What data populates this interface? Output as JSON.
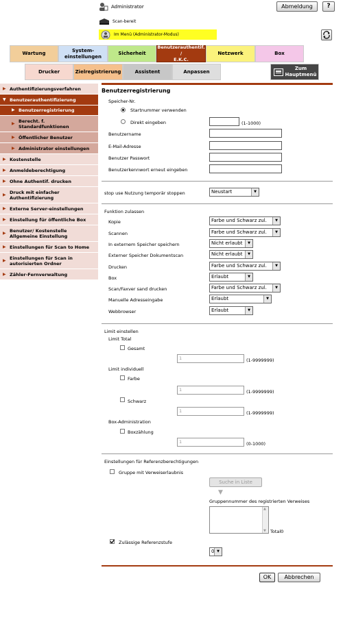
{
  "header": {
    "user": "Administrator",
    "logout": "Abmeldung",
    "help": "?",
    "status": "Scan-bereit",
    "mode": "Im Menü (Administrator-Modus)"
  },
  "tabs_row1": [
    "Wartung",
    "System-\neinstellungen",
    "Sicherheit",
    "Benutzerauthentif. /\nE.K.C.",
    "Netzwerk",
    "Box"
  ],
  "tabs_row2": [
    "Drucker",
    "Zielregistrierung",
    "Assistent",
    "Anpassen"
  ],
  "home_button": "Zum\nHauptmenü",
  "sidebar": [
    "Authentifizierungsverfahren",
    "Benutzerauthentifizierung",
    "Benutzerregistrierung",
    "Berecht. f.\nStandardfunktionen",
    "Öffentlicher Benutzer",
    "Administrator einstellungen",
    "Kostenstelle",
    "Anmeldeberechtigung",
    "Ohne Authentif. drucken",
    "Druck mit einfacher\nAuthentifizierung",
    "Externe Server-einstellungen",
    "Einstellung für öffentliche Box",
    "Benutzer/ Kostenstelle\nAllgemeine Einstellung",
    "Einstellungen für Scan to Home",
    "Einstellungen für Scan in\nautorisierten Ordner",
    "Zähler-Fernverwaltung"
  ],
  "form": {
    "title": "Benutzerregistrierung",
    "speicher_label": "Speicher-Nr.",
    "radio1": "Startnummer verwenden",
    "radio2": "Direkt eingeben",
    "range_1000": "(1-1000)",
    "username": "Benutzername",
    "email": "E-Mail-Adresse",
    "password": "Benutzer Passwort",
    "password2": "Benutzerkennwort erneut eingeben",
    "stop_label": "stop use Nutzung temporär stoppen",
    "stop_value": "Neustart",
    "funktion_title": "Funktion zulassen",
    "functions": [
      {
        "label": "Kopie",
        "value": "Farbe und Schwarz zul."
      },
      {
        "label": "Scannen",
        "value": "Farbe und Schwarz zul."
      },
      {
        "label": "In externem Speicher speichern",
        "value": "Nicht erlaubt"
      },
      {
        "label": "Externer Speicher Dokumentscan",
        "value": "Nicht erlaubt"
      },
      {
        "label": "Drucken",
        "value": "Farbe und Schwarz zul."
      },
      {
        "label": "Box",
        "value": "Erlaubt"
      },
      {
        "label": "Scan/Faxver sand drucken",
        "value": "Farbe und Schwarz zul."
      },
      {
        "label": "Manuelle Adresseingabe",
        "value": "Erlaubt"
      },
      {
        "label": "Webbrowser",
        "value": "Erlaubt"
      }
    ],
    "limit_title": "Limit einstellen",
    "limit_total": "Limit Total",
    "gesamt": "Gesamt",
    "limit_individuell": "Limit individuell",
    "farbe": "Farbe",
    "schwarz": "Schwarz",
    "box_admin": "Box-Administration",
    "boxzahlung": "Boxzählung",
    "input_value": "1",
    "range_9999999": "(1-9999999)",
    "range_0_1000": "(0-1000)",
    "ref_title": "Einstellungen für Referenzberechtigungen",
    "gruppe": "Gruppe mit Verweiserlaubnis",
    "suche": "Suche in Liste",
    "gruppennummer": "Gruppennummer des registrierten Verweises",
    "total": "Total0",
    "zulaessige": "Zulässige Referenzstufe",
    "ref_value": "0",
    "ok": "OK",
    "abbrechen": "Abbrechen"
  }
}
